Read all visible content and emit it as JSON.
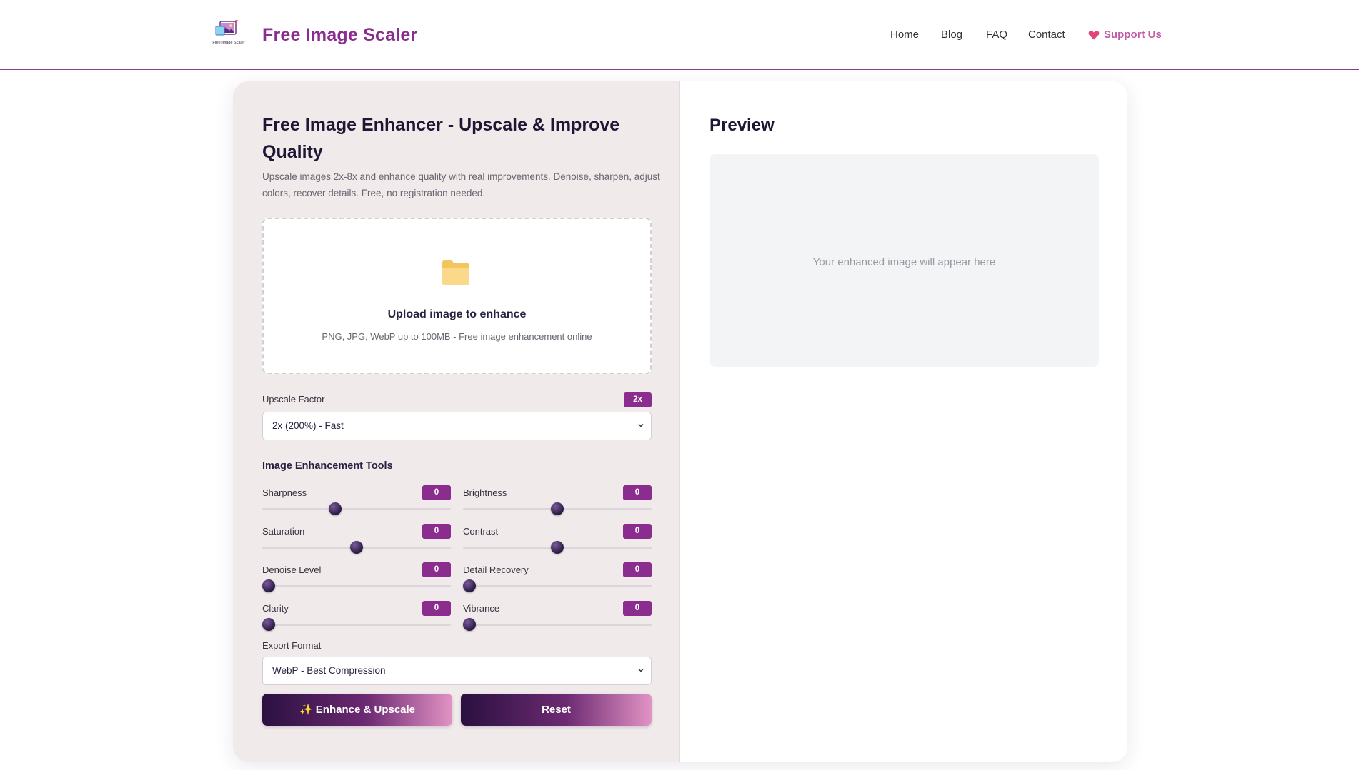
{
  "header": {
    "brand": "Free Image Scaler",
    "logo_caption": "Free Image Scaler",
    "nav": [
      {
        "label": "Home"
      },
      {
        "label": "Blog"
      },
      {
        "label": "FAQ"
      },
      {
        "label": "Contact"
      }
    ],
    "support_label": "Support Us",
    "support_icon": "heart-icon"
  },
  "tool": {
    "title": "Free Image Enhancer - Upscale & Improve Quality",
    "subtitle": "Upscale images 2x-8x and enhance quality with real improvements. Denoise, sharpen, adjust colors, recover details. Free, no registration needed.",
    "upload": {
      "icon": "folder-icon",
      "title": "Upload image to enhance",
      "hint": "PNG, JPG, WebP up to 100MB - Free image enhancement online"
    },
    "upscale": {
      "label": "Upscale Factor",
      "badge": "2x",
      "selected": "2x (200%) - Fast"
    },
    "tools_heading": "Image Enhancement Tools",
    "sliders": [
      {
        "label": "Sharpness",
        "value": "0",
        "position": 0.38
      },
      {
        "label": "Brightness",
        "value": "0",
        "position": 0.5
      },
      {
        "label": "Saturation",
        "value": "0",
        "position": 0.5
      },
      {
        "label": "Contrast",
        "value": "0",
        "position": 0.5
      },
      {
        "label": "Denoise Level",
        "value": "0",
        "position": 0.0
      },
      {
        "label": "Detail Recovery",
        "value": "0",
        "position": 0.0
      },
      {
        "label": "Clarity",
        "value": "0",
        "position": 0.0
      },
      {
        "label": "Vibrance",
        "value": "0",
        "position": 0.0
      }
    ],
    "export": {
      "label": "Export Format",
      "selected": "WebP - Best Compression"
    },
    "buttons": {
      "enhance": "✨ Enhance & Upscale",
      "reset": "Reset"
    }
  },
  "preview": {
    "title": "Preview",
    "placeholder": "Your enhanced image will appear here"
  },
  "colors": {
    "accent": "#8b2d8e",
    "panel_bg": "#f0eaea"
  }
}
